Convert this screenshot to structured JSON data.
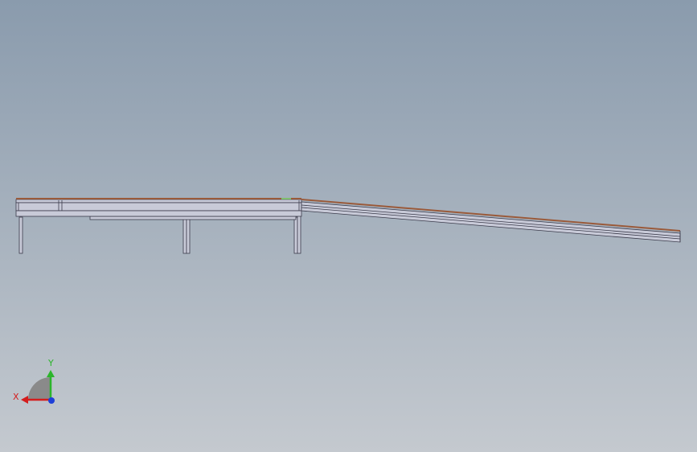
{
  "viewport": {
    "background_top": "#8a9bad",
    "background_bottom": "#c4c9cf"
  },
  "model": {
    "steel_fill": "#c8cad8",
    "steel_stroke": "#3a3a4a",
    "deck_color": "#9a5a3a",
    "accent_color": "#7fbf6f"
  },
  "triad": {
    "x_label": "X",
    "y_label": "Y",
    "x_color": "#d41d1d",
    "y_color": "#2bb52b",
    "z_color": "#1e3fd8",
    "arc_color": "#8a8a8a"
  }
}
